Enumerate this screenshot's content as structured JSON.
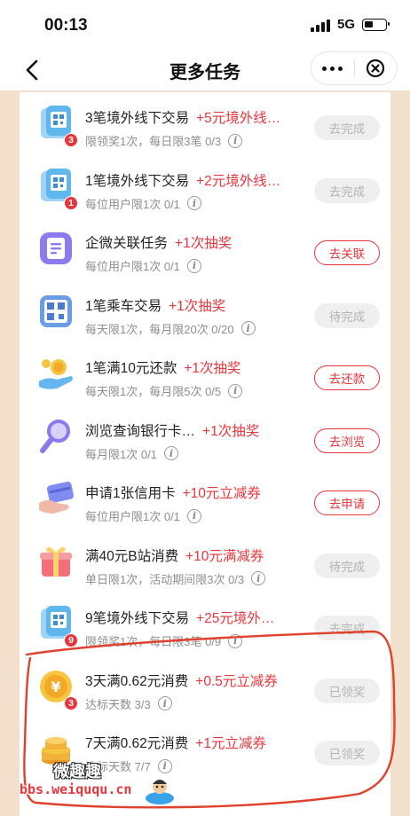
{
  "status": {
    "time": "00:13",
    "network": "5G"
  },
  "nav": {
    "title": "更多任务"
  },
  "tasks": [
    {
      "title": "3笔境外线下交易",
      "reward": "+5元境外线…",
      "limit": "限领奖1次，每日限3笔 0/3",
      "button": "去完成",
      "style": "gray",
      "badge": "3",
      "icon": "qr-card-icon"
    },
    {
      "title": "1笔境外线下交易",
      "reward": "+2元境外线…",
      "limit": "每位用户限1次 0/1",
      "button": "去完成",
      "style": "gray",
      "badge": "1",
      "icon": "qr-card-icon"
    },
    {
      "title": "企微关联任务",
      "reward": "+1次抽奖",
      "limit": "每位用户限1次 0/1",
      "button": "去关联",
      "style": "red",
      "badge": "",
      "icon": "document-icon"
    },
    {
      "title": "1笔乘车交易",
      "reward": "+1次抽奖",
      "limit": "每天限1次，每月限20次 0/20",
      "button": "待完成",
      "style": "gray",
      "badge": "",
      "icon": "transit-qr-icon"
    },
    {
      "title": "1笔满10元还款",
      "reward": "+1次抽奖",
      "limit": "每天限1次，每月限5次 0/5",
      "button": "去还款",
      "style": "red",
      "badge": "",
      "icon": "coin-hand-icon"
    },
    {
      "title": "浏览查询银行卡…",
      "reward": "+1次抽奖",
      "limit": "每月限1次 0/1",
      "button": "去浏览",
      "style": "red",
      "badge": "",
      "icon": "magnifier-icon"
    },
    {
      "title": "申请1张信用卡",
      "reward": "+10元立减券",
      "limit": "每位用户限1次 0/1",
      "button": "去申请",
      "style": "red",
      "badge": "",
      "icon": "credit-card-hand-icon"
    },
    {
      "title": "满40元B站消费",
      "reward": "+10元满减券",
      "limit": "单日限1次，活动期间限3次 0/3",
      "button": "待完成",
      "style": "gray",
      "badge": "",
      "icon": "gift-box-icon"
    },
    {
      "title": "9笔境外线下交易",
      "reward": "+25元境外…",
      "limit": "限领奖1次，每日限3笔 0/9",
      "button": "去完成",
      "style": "gray",
      "badge": "9",
      "icon": "qr-card-icon"
    },
    {
      "title": "3天满0.62元消费",
      "reward": "+0.5元立减券",
      "limit": "达标天数 3/3",
      "button": "已领奖",
      "style": "gray",
      "badge": "3",
      "icon": "gold-coin-icon"
    },
    {
      "title": "7天满0.62元消费",
      "reward": "+1元立减券",
      "limit": "达标天数 7/7",
      "button": "已领奖",
      "style": "gray",
      "badge": "",
      "icon": "coin-stack-icon"
    }
  ],
  "watermark": {
    "line1": "微趣趣",
    "line2": "bbs.weiququ.cn"
  },
  "colors": {
    "accent": "#e8363c",
    "frame": "#f4e1cd",
    "annotation": "#e0412c"
  }
}
